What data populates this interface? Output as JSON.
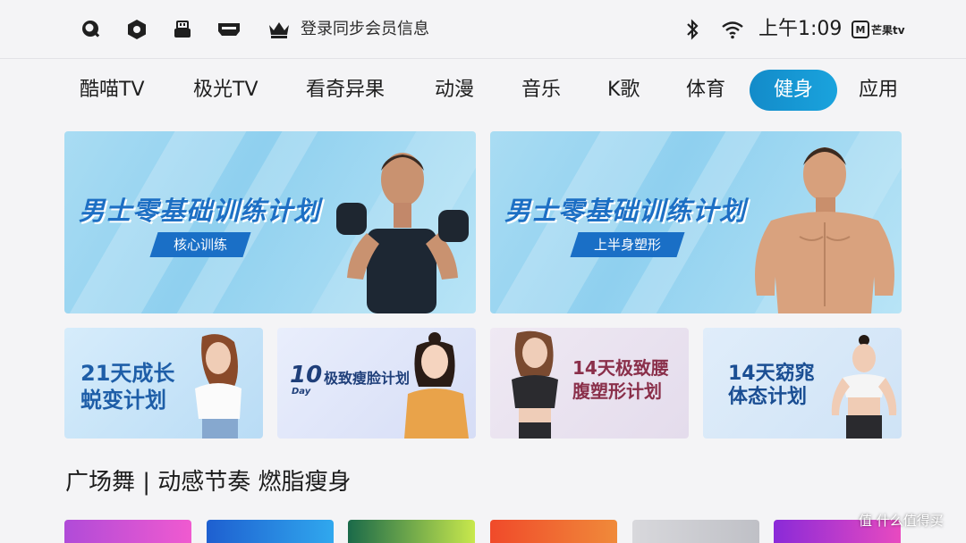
{
  "status_bar": {
    "icons": [
      "search-icon",
      "settings-hexagon-icon",
      "usb-drive-icon",
      "hdmi-icon",
      "crown-icon"
    ],
    "login_text": "登录同步会员信息",
    "right_icons": [
      "bluetooth-icon",
      "wifi-icon"
    ],
    "time": "上午1:09",
    "brand": "芒果tv"
  },
  "nav": {
    "tabs": [
      "酷喵TV",
      "极光TV",
      "看奇异果",
      "动漫",
      "音乐",
      "K歌",
      "体育",
      "健身",
      "应用"
    ],
    "active_index": 7,
    "active_color": "#1597d2"
  },
  "banners": [
    {
      "headline": "男士零基础训练计划",
      "tag": "核心训练"
    },
    {
      "headline": "男士零基础训练计划",
      "tag": "上半身塑形"
    }
  ],
  "cards": [
    {
      "line1": "21天成长",
      "line2": "蜕变计划"
    },
    {
      "number": "10",
      "day": "Day",
      "title": "极致瘦脸计划"
    },
    {
      "line1": "14天极致腰",
      "line2": "腹塑形计划"
    },
    {
      "line1": "14天窈窕",
      "line2": "体态计划"
    }
  ],
  "section": {
    "title": "广场舞 | 动感节奏 燃脂瘦身"
  },
  "watermark": "值 什么值得买"
}
